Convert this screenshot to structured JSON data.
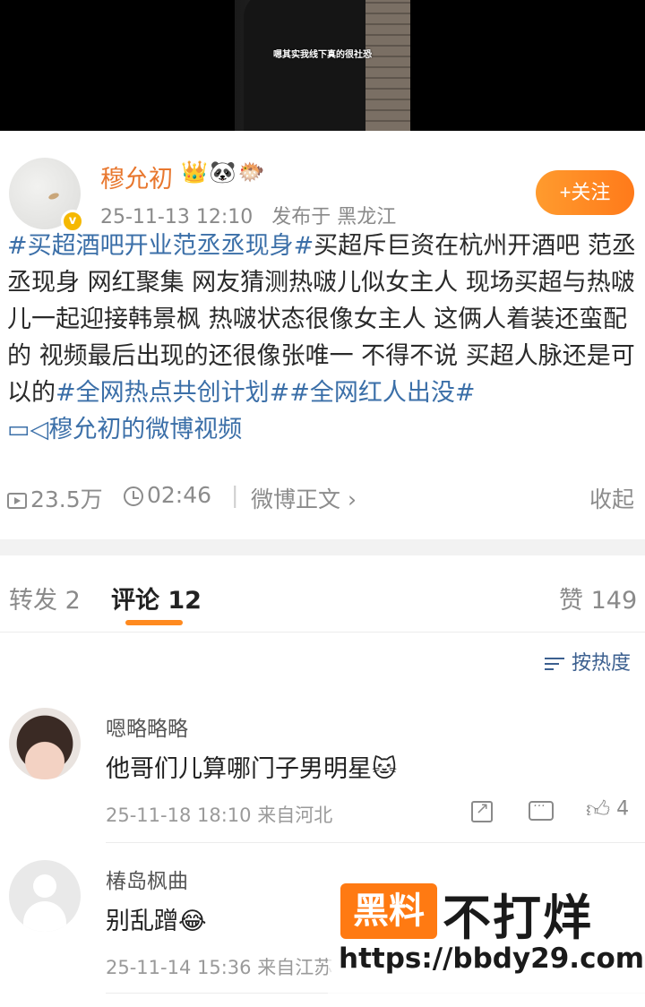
{
  "video": {
    "caption": "嗯其实我线下真的很社恐"
  },
  "post": {
    "author": "穆允初",
    "badges": "👑🐼🐡",
    "verified_mark": "v",
    "date": "25-11-13 12:10",
    "location": "发布于 黑龙江",
    "follow_label": "+关注",
    "text_segments": [
      {
        "text": "#买超酒吧开业范丞丞现身#",
        "type": "tag"
      },
      {
        "text": "买超斥巨资在杭州开酒吧 范丞丞现身 网红聚集 网友猜测热啵儿似女主人 现场买超与热啵儿一起迎接韩景枫 热啵状态很像女主人 这俩人着装还蛮配的 视频最后出现的还很像张唯一 不得不说 买超人脉还是可以的",
        "type": "plain"
      },
      {
        "text": "#全网热点共创计划#",
        "type": "tag"
      },
      {
        "text": "#全网红人出没#",
        "type": "tag"
      },
      {
        "text": "穆允初的微博视频",
        "type": "link"
      }
    ],
    "views": "23.5万",
    "duration": "02:46",
    "source": "微博正文",
    "collapse": "收起"
  },
  "tabs": {
    "repost": "转发 2",
    "comments": "评论 12",
    "likes": "赞 149"
  },
  "sort_label": "按热度",
  "comments": [
    {
      "name": "嗯略略略",
      "text": "他哥们儿算哪门子男明星🐱",
      "time": "25-11-18 18:10",
      "location": "来自河北",
      "likes": "4"
    },
    {
      "name": "椿岛枫曲",
      "text": "别乱蹭😂",
      "time": "25-11-14 15:36",
      "location": "来自江苏"
    }
  ],
  "watermark": {
    "logo": "黑料",
    "title": "不打烊",
    "url": "https://bbdy29.com"
  }
}
